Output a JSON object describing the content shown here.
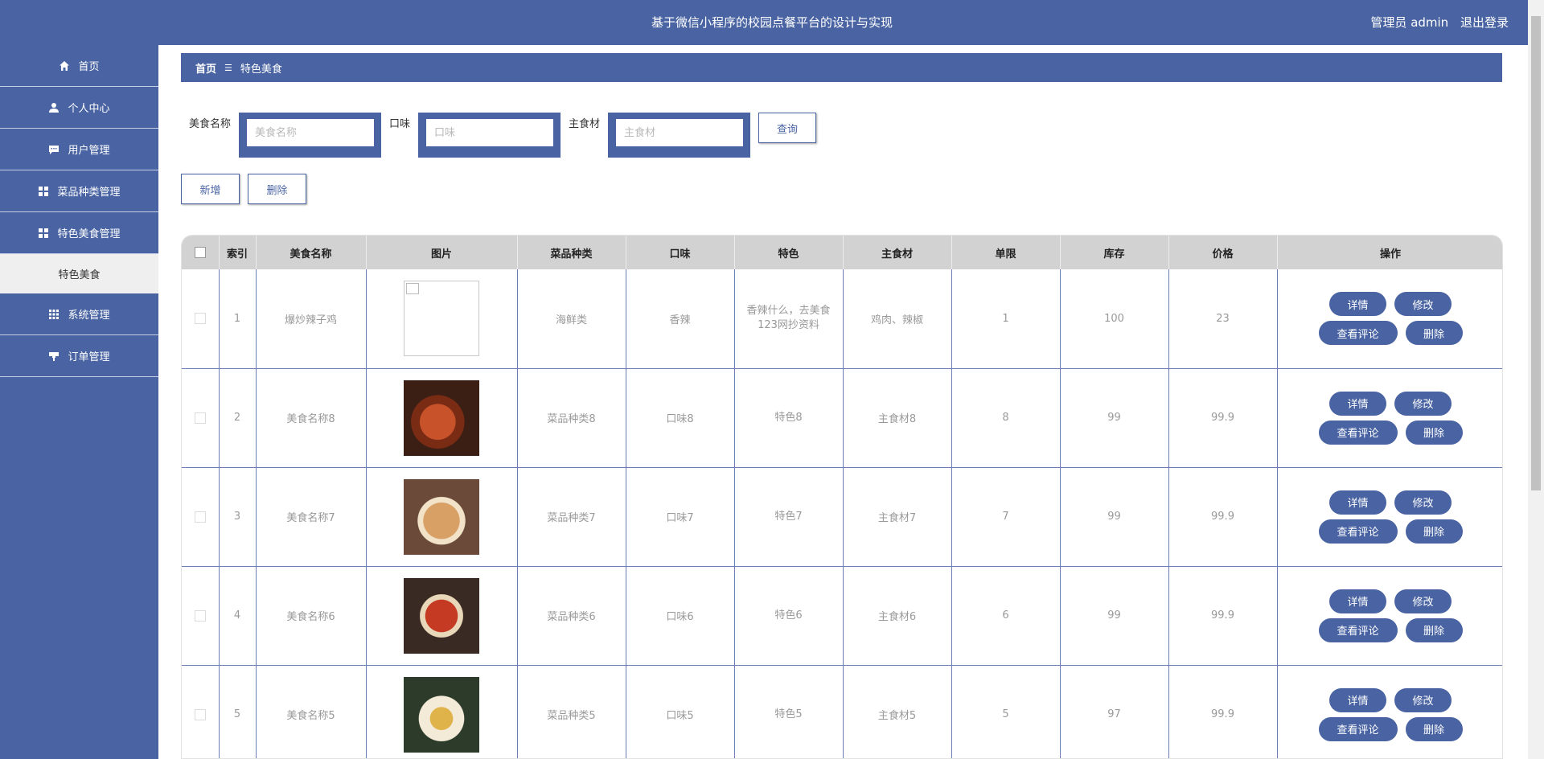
{
  "header": {
    "title": "基于微信小程序的校园点餐平台的设计与实现",
    "role": "管理员 admin",
    "logout": "退出登录"
  },
  "sidebar": {
    "items": [
      {
        "label": "首页",
        "icon": "home-icon"
      },
      {
        "label": "个人中心",
        "icon": "user-icon"
      },
      {
        "label": "用户管理",
        "icon": "chat-icon"
      },
      {
        "label": "菜品种类管理",
        "icon": "grid-icon"
      },
      {
        "label": "特色美食管理",
        "icon": "grid-icon"
      },
      {
        "label": "特色美食",
        "icon": ""
      },
      {
        "label": "系统管理",
        "icon": "apps-icon"
      },
      {
        "label": "订单管理",
        "icon": "cup-icon"
      }
    ]
  },
  "breadcrumb": {
    "home": "首页",
    "current": "特色美食"
  },
  "search": {
    "name_label": "美食名称",
    "name_placeholder": "美食名称",
    "taste_label": "口味",
    "taste_placeholder": "口味",
    "ingredient_label": "主食材",
    "ingredient_placeholder": "主食材",
    "query": "查询"
  },
  "actions": {
    "add": "新增",
    "delete": "删除"
  },
  "table": {
    "headers": [
      "索引",
      "美食名称",
      "图片",
      "菜品种类",
      "口味",
      "特色",
      "主食材",
      "单限",
      "库存",
      "价格",
      "操作"
    ],
    "rows": [
      {
        "index": "1",
        "name": "爆炒辣子鸡",
        "category": "海鲜类",
        "taste": "香辣",
        "feature": "香辣什么，去美食123网抄资料",
        "ingredient": "鸡肉、辣椒",
        "limit": "1",
        "stock": "100",
        "price": "23",
        "img": "broken"
      },
      {
        "index": "2",
        "name": "美食名称8",
        "category": "菜品种类8",
        "taste": "口味8",
        "feature": "特色8",
        "ingredient": "主食材8",
        "limit": "8",
        "stock": "99",
        "price": "99.9",
        "img": "soup"
      },
      {
        "index": "3",
        "name": "美食名称7",
        "category": "菜品种类7",
        "taste": "口味7",
        "feature": "特色7",
        "ingredient": "主食材7",
        "limit": "7",
        "stock": "99",
        "price": "99.9",
        "img": "noodle"
      },
      {
        "index": "4",
        "name": "美食名称6",
        "category": "菜品种类6",
        "taste": "口味6",
        "feature": "特色6",
        "ingredient": "主食材6",
        "limit": "6",
        "stock": "99",
        "price": "99.9",
        "img": "shrimp"
      },
      {
        "index": "5",
        "name": "美食名称5",
        "category": "菜品种类5",
        "taste": "口味5",
        "feature": "特色5",
        "ingredient": "主食材5",
        "limit": "5",
        "stock": "97",
        "price": "99.9",
        "img": "rice"
      }
    ],
    "op_detail": "详情",
    "op_edit": "修改",
    "op_comments": "查看评论",
    "op_delete": "删除"
  },
  "colors": {
    "primary": "#4a64a3",
    "header_bg": "#d2d2d2"
  }
}
